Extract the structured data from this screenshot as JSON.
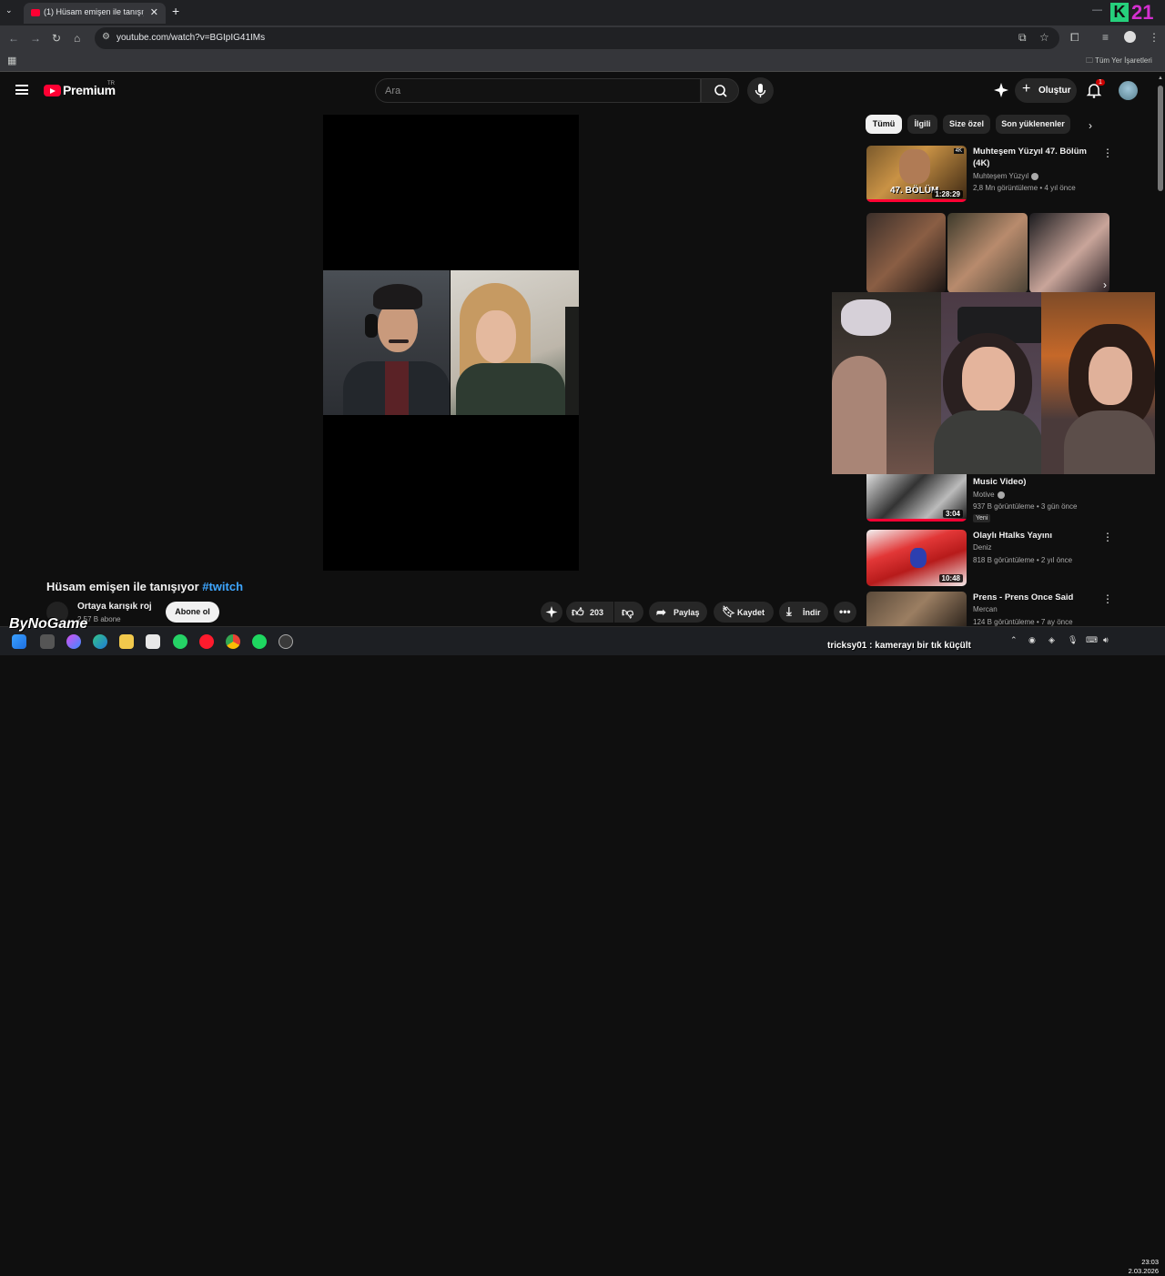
{
  "browser": {
    "tab_title": "(1) Hüsam emişen ile tanışıyor",
    "url": "youtube.com/watch?v=BGIpIG41IMs",
    "bookmarks_all": "Tüm Yer İşaretleri",
    "overlay_logo_k": "K",
    "overlay_logo_num": "21"
  },
  "masthead": {
    "logo_text": "Premium",
    "region": "TR",
    "search_placeholder": "Ara",
    "create_label": "Oluştur",
    "notification_count": "1"
  },
  "video": {
    "title": "Hüsam emişen ile tanışıyor",
    "hashtag": "#twitch",
    "channel_name": "Ortaya karışık roj",
    "channel_subs": "2,57 B abone",
    "subscribe_label": "Abone ol",
    "like_count": "203",
    "share_label": "Paylaş",
    "save_label": "Kaydet",
    "download_label": "İndir",
    "more_icon": "more-horizontal-icon"
  },
  "chips": [
    {
      "label": "Tümü",
      "active": true
    },
    {
      "label": "İlgili",
      "active": false
    },
    {
      "label": "Size özel",
      "active": false
    },
    {
      "label": "Son yüklenenler",
      "active": false
    }
  ],
  "recommendations": [
    {
      "title": "Muhteşem Yüzyıl 47. Bölüm (4K)",
      "channel": "Muhteşem Yüzyıl",
      "meta": "2,8 Mn görüntüleme • 4 yıl önce",
      "duration": "1:28:29",
      "thumb_text": "47. BÖLÜM",
      "badge": "4K"
    },
    {
      "title": "Music Video)",
      "channel": "Motive",
      "meta": "937 B görüntüleme • 3 gün önce",
      "duration": "3:04",
      "new_badge": "Yeni"
    },
    {
      "title": "Olaylı Htalks Yayını",
      "channel": "Deniz",
      "meta": "818 B görüntüleme • 2 yıl önce",
      "duration": "10:48"
    },
    {
      "title": "Prens - Prens Once Said",
      "channel": "Mercan",
      "meta": "124 B görüntüleme • 7 ay önce",
      "duration": ""
    }
  ],
  "stream_overlay": {
    "watermark": "ByNoGame",
    "chat_message": "tricksy01 : kamerayı bir tık küçült"
  },
  "taskbar": {
    "time": "23:03",
    "date": "2.03.2026"
  },
  "colors": {
    "brand_red": "#ff0033",
    "link_blue": "#3ea6ff",
    "background": "#0f0f0f"
  }
}
